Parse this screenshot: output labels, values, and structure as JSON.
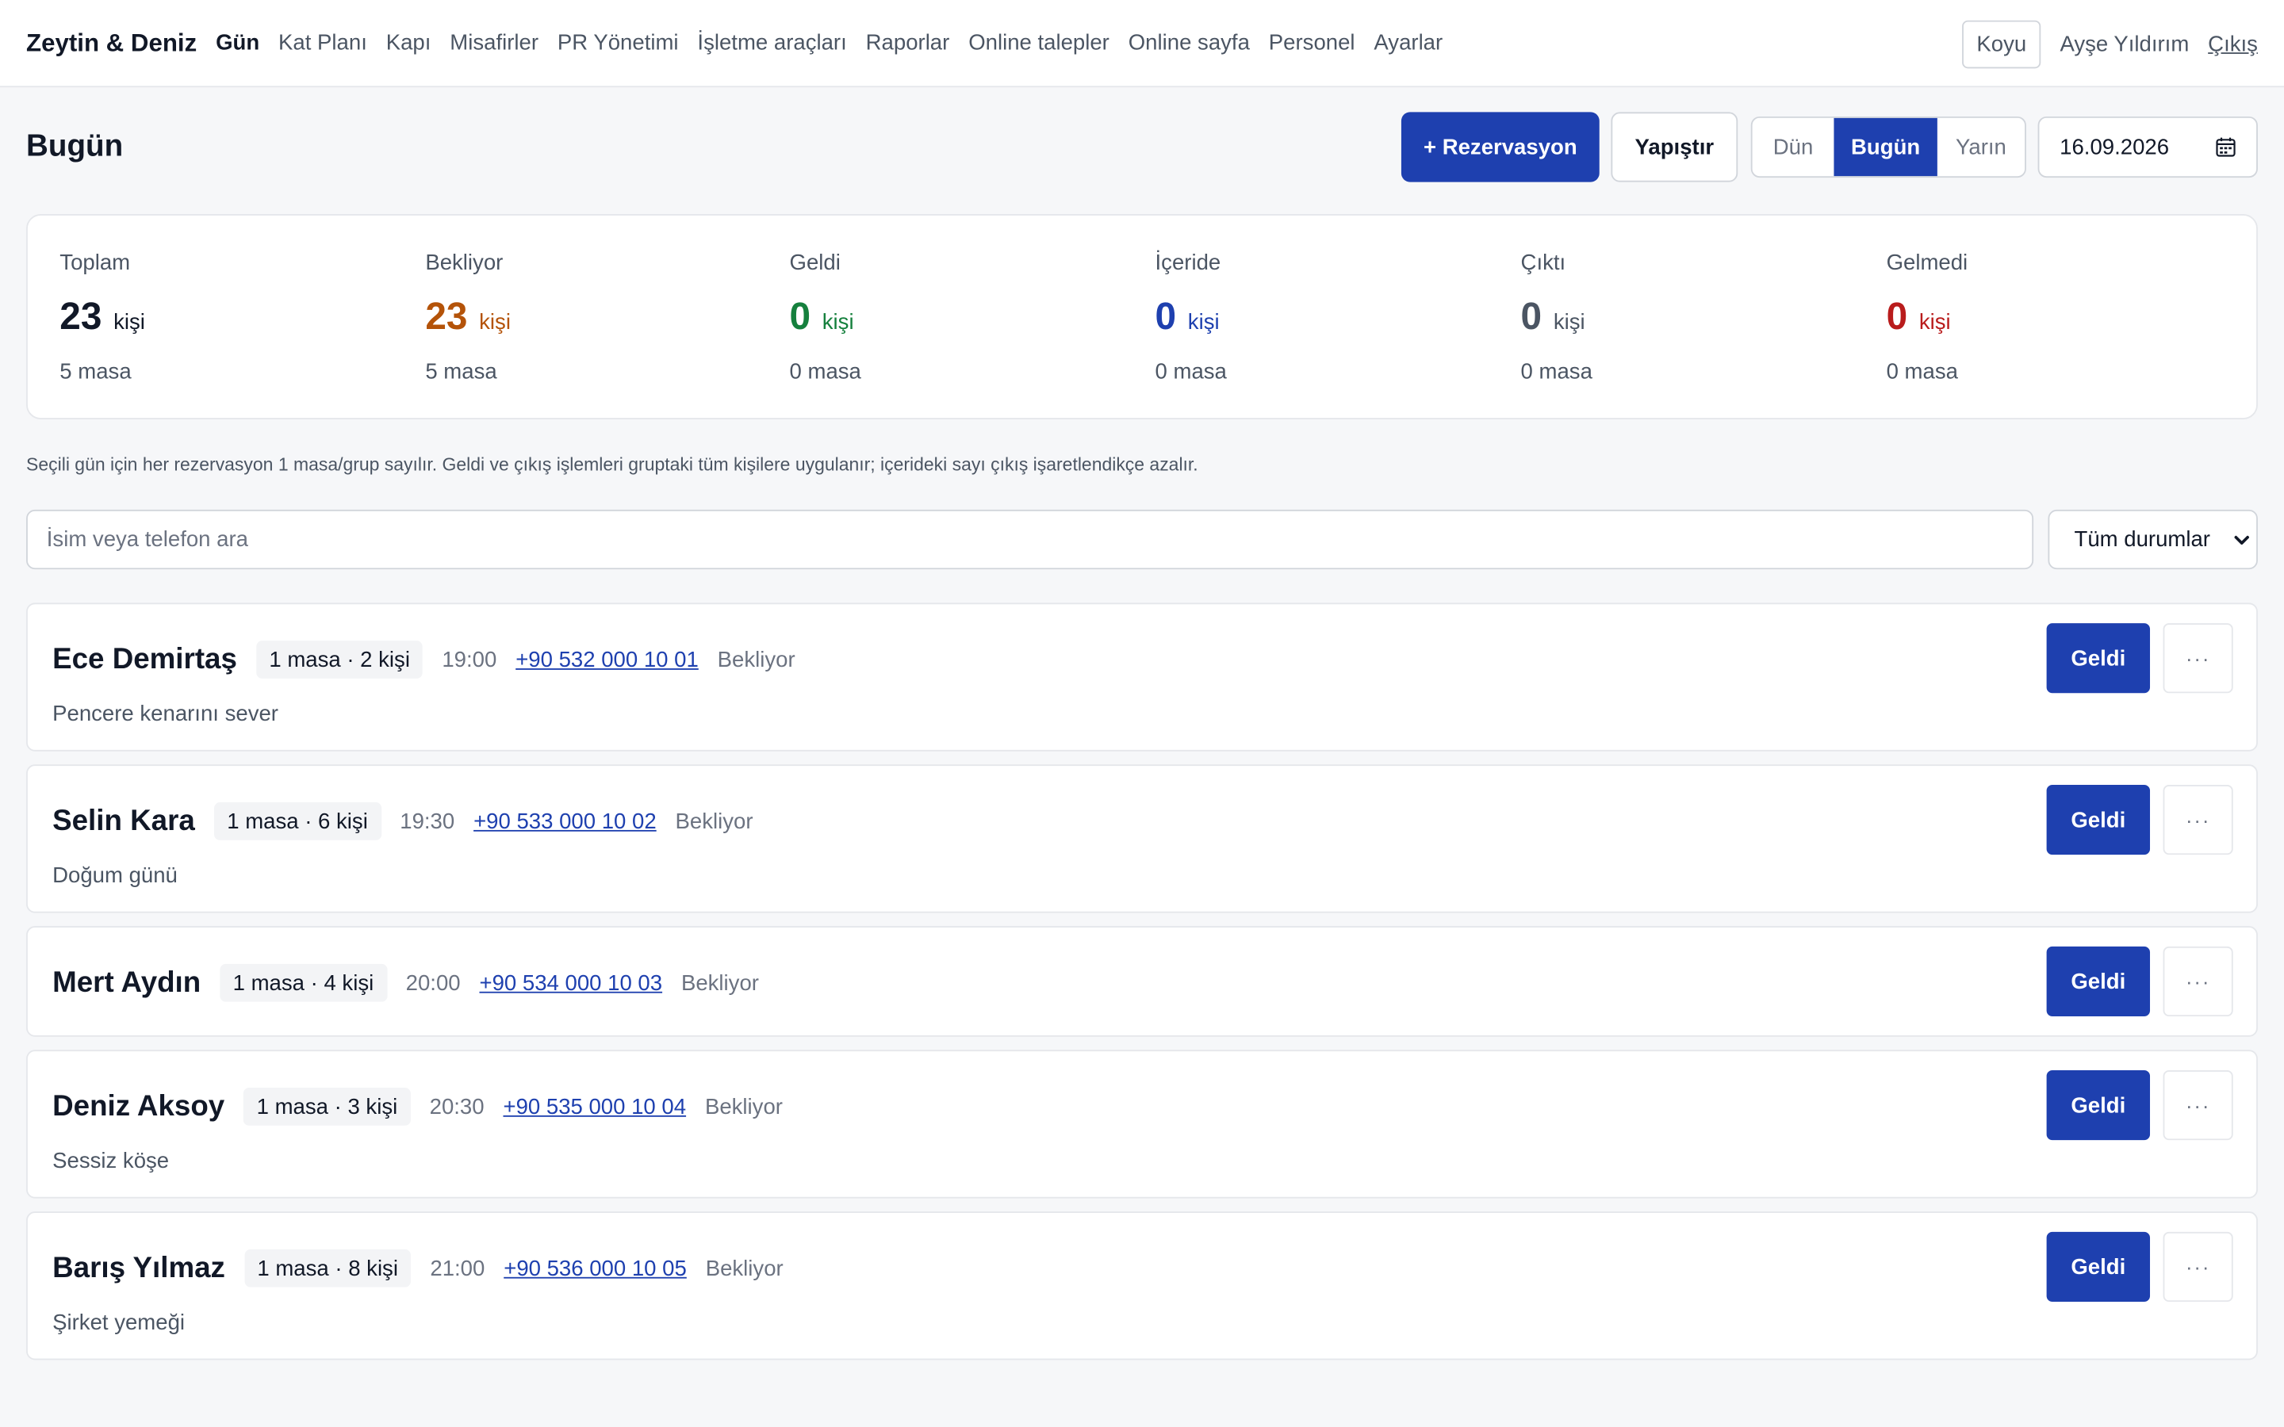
{
  "nav": {
    "brand": "Zeytin & Deniz",
    "items": [
      {
        "label": "Gün",
        "active": true
      },
      {
        "label": "Kat Planı"
      },
      {
        "label": "Kapı"
      },
      {
        "label": "Misafirler"
      },
      {
        "label": "PR Yönetimi"
      },
      {
        "label": "İşletme araçları"
      },
      {
        "label": "Raporlar"
      },
      {
        "label": "Online talepler"
      },
      {
        "label": "Online sayfa"
      },
      {
        "label": "Personel"
      },
      {
        "label": "Ayarlar"
      }
    ],
    "theme_label": "Koyu",
    "user_name": "Ayşe Yıldırım",
    "logout_label": "Çıkış"
  },
  "header": {
    "title": "Bugün",
    "new_reservation_label": "+ Rezervasyon",
    "paste_label": "Yapıştır",
    "day_segments": [
      "Dün",
      "Bugün",
      "Yarın"
    ],
    "active_segment": "Bugün",
    "date_value": "16.09.2026",
    "calendar_icon": "calendar-icon"
  },
  "stats": [
    {
      "label": "Toplam",
      "value": "23",
      "unit": "kişi",
      "tables": "5 masa",
      "color": "#111827"
    },
    {
      "label": "Bekliyor",
      "value": "23",
      "unit": "kişi",
      "tables": "5 masa",
      "color": "#b45309"
    },
    {
      "label": "Geldi",
      "value": "0",
      "unit": "kişi",
      "tables": "0 masa",
      "color": "#15803d"
    },
    {
      "label": "İçeride",
      "value": "0",
      "unit": "kişi",
      "tables": "0 masa",
      "color": "#1e40af"
    },
    {
      "label": "Çıktı",
      "value": "0",
      "unit": "kişi",
      "tables": "0 masa",
      "color": "#4b5563"
    },
    {
      "label": "Gelmedi",
      "value": "0",
      "unit": "kişi",
      "tables": "0 masa",
      "color": "#b91c1c"
    }
  ],
  "info_note": "Seçili gün için her rezervasyon 1 masa/grup sayılır. Geldi ve çıkış işlemleri gruptaki tüm kişilere uygulanır; içerideki sayı çıkış işaretlendikçe azalır.",
  "filters": {
    "search_placeholder": "İsim veya telefon ara",
    "search_value": "",
    "status_selected": "Tüm durumlar",
    "chevron_icon": "chevron-down-icon"
  },
  "reservations": [
    {
      "name": "Ece Demirtaş",
      "badge": "1 masa · 2 kişi",
      "time": "19:00",
      "phone": "+90 532 000 10 01",
      "status": "Bekliyor",
      "note": "Pencere kenarını sever",
      "action_label": "Geldi",
      "more_label": "···"
    },
    {
      "name": "Selin Kara",
      "badge": "1 masa · 6 kişi",
      "time": "19:30",
      "phone": "+90 533 000 10 02",
      "status": "Bekliyor",
      "note": "Doğum günü",
      "action_label": "Geldi",
      "more_label": "···"
    },
    {
      "name": "Mert Aydın",
      "badge": "1 masa · 4 kişi",
      "time": "20:00",
      "phone": "+90 534 000 10 03",
      "status": "Bekliyor",
      "note": "",
      "action_label": "Geldi",
      "more_label": "···"
    },
    {
      "name": "Deniz Aksoy",
      "badge": "1 masa · 3 kişi",
      "time": "20:30",
      "phone": "+90 535 000 10 04",
      "status": "Bekliyor",
      "note": "Sessiz köşe",
      "action_label": "Geldi",
      "more_label": "···"
    },
    {
      "name": "Barış Yılmaz",
      "badge": "1 masa · 8 kişi",
      "time": "21:00",
      "phone": "+90 536 000 10 05",
      "status": "Bekliyor",
      "note": "Şirket yemeği",
      "action_label": "Geldi",
      "more_label": "···"
    }
  ]
}
